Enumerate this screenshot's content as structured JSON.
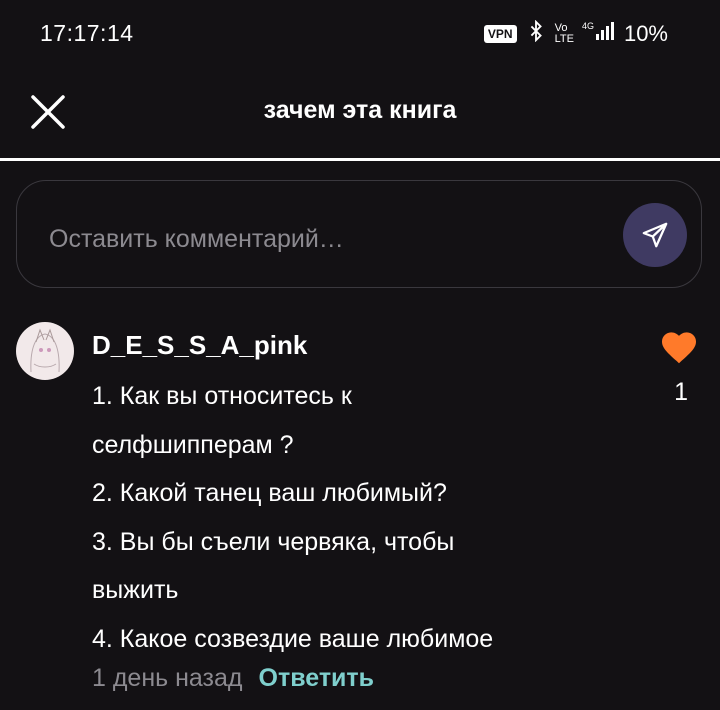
{
  "status_bar": {
    "time": "17:17:14",
    "vpn": "VPN",
    "battery": "10%"
  },
  "header": {
    "title": "зачем эта книга"
  },
  "composer": {
    "placeholder": "Оставить комментарий…"
  },
  "comment": {
    "username": "D_E_S_S_A_pink",
    "lines": [
      "1. Как вы относитесь к",
      "селфшипперам ?",
      "2. Какой танец ваш любимый?",
      "3. Вы бы съели червяка, чтобы",
      "выжить",
      "4. Какое созвездие ваше любимое"
    ],
    "time_ago": "1 день назад",
    "reply_label": "Ответить",
    "likes": "1"
  },
  "colors": {
    "background": "#131114",
    "heart": "#ff7a2a",
    "reply": "#7fcfcd",
    "send_button": "#3f3a62"
  },
  "icons": {
    "close": "close-icon",
    "send": "send-icon",
    "like": "heart-icon"
  }
}
